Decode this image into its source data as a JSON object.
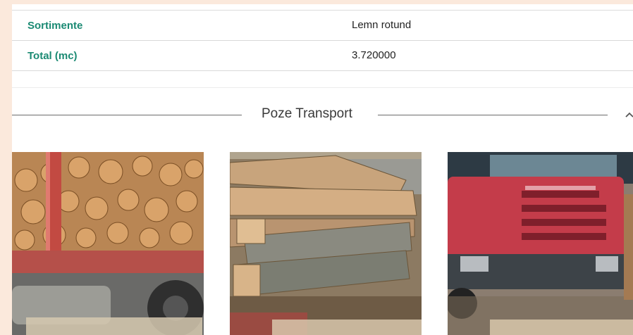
{
  "details": {
    "rows": [
      {
        "label": "Sortimente",
        "value": "Lemn rotund"
      },
      {
        "label": "Total (mc)",
        "value": "3.720000"
      }
    ]
  },
  "transport_section": {
    "title": "Poze Transport",
    "toggle_icon": "chevron-up-icon",
    "photos": [
      {
        "subject": "firewood-logs-on-truck"
      },
      {
        "subject": "wood-beams-on-trailer"
      },
      {
        "subject": "red-truck-front"
      }
    ]
  },
  "colors": {
    "page_background": "#fbe9dc",
    "label_green": "#1b8a73"
  }
}
